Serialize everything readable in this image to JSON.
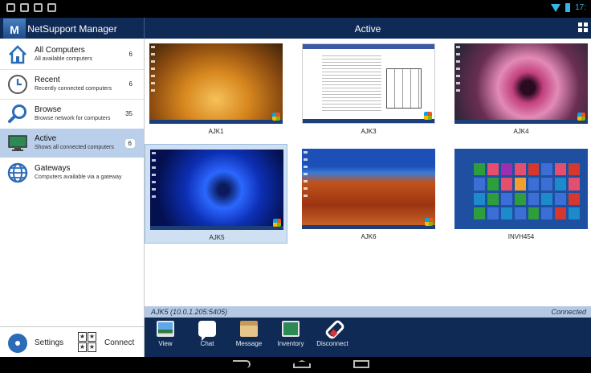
{
  "status_bar": {
    "time": "17:"
  },
  "header": {
    "app_logo_letter": "M",
    "app_title": "NetSupport Manager",
    "view_title": "Active"
  },
  "sidebar": {
    "items": [
      {
        "title": "All Computers",
        "subtitle": "All available computers",
        "count": "6",
        "icon": "house-icon"
      },
      {
        "title": "Recent",
        "subtitle": "Recently connected computers",
        "count": "6",
        "icon": "clock-icon"
      },
      {
        "title": "Browse",
        "subtitle": "Browse network for computers",
        "count": "35",
        "icon": "magnifier-icon"
      },
      {
        "title": "Active",
        "subtitle": "Shows all connected computers",
        "count": "6",
        "icon": "monitor-icon",
        "selected": true
      },
      {
        "title": "Gateways",
        "subtitle": "Computers available via a gateway",
        "count": "",
        "icon": "globe-icon"
      }
    ],
    "settings_label": "Settings",
    "connect_label": "Connect"
  },
  "computers": [
    {
      "name": "AJK1",
      "wallpaper": "autumn"
    },
    {
      "name": "AJK3",
      "wallpaper": "document"
    },
    {
      "name": "AJK4",
      "wallpaper": "flower"
    },
    {
      "name": "AJK5",
      "wallpaper": "blue-burst",
      "selected": true
    },
    {
      "name": "AJK6",
      "wallpaper": "desert"
    },
    {
      "name": "INVH454",
      "wallpaper": "metro-start"
    }
  ],
  "info_bar": {
    "selection": "AJK5 (10.0.1.205:5405)",
    "status": "Connected"
  },
  "toolbar": {
    "view": "View",
    "chat": "Chat",
    "message": "Message",
    "inventory": "Inventory",
    "disconnect": "Disconnect"
  },
  "colors": {
    "header_bg": "#0f2a55",
    "selected_bg": "#b9cfea",
    "info_bar_bg": "#b5c9e3",
    "status_accent": "#33b5e5"
  }
}
